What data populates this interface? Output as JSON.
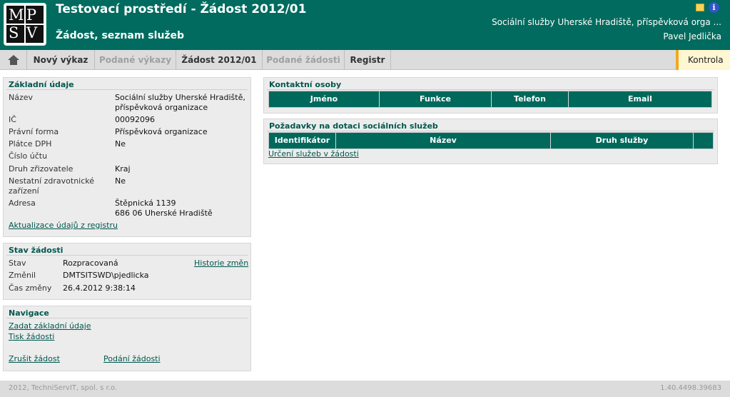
{
  "header": {
    "logo_letters": [
      "M",
      "P",
      "S",
      "V"
    ],
    "title": "Testovací prostředí - Žádost 2012/01",
    "subtitle": "Žádost, seznam služeb",
    "organization": "Sociální služby Uherské Hradiště, příspěvková orga ...",
    "user": "Pavel Jedlička",
    "icons": [
      "note-icon",
      "info-icon"
    ],
    "accent_color": "#006b5e"
  },
  "nav": {
    "items": [
      {
        "label": "Nový výkaz",
        "enabled": true
      },
      {
        "label": "Podané výkazy",
        "enabled": false
      },
      {
        "label": "Žádost 2012/01",
        "enabled": true
      },
      {
        "label": "Podané žádosti",
        "enabled": false
      },
      {
        "label": "Registr",
        "enabled": true
      }
    ],
    "kontrola": "Kontrola",
    "home_icon": "home-icon"
  },
  "zakladni": {
    "title": "Základní údaje",
    "rows": [
      {
        "label": "Název",
        "value": "Sociální služby Uherské Hradiště,",
        "value2": "příspěvková organizace"
      },
      {
        "label": "IČ",
        "value": "00092096"
      },
      {
        "label": "Právní forma",
        "value": "Příspěvková organizace"
      },
      {
        "label": "Plátce DPH",
        "value": "Ne"
      },
      {
        "label": "Číslo účtu",
        "value": ""
      },
      {
        "label": "Druh zřizovatele",
        "value": "Kraj"
      },
      {
        "label": "Nestatní zdravotnické",
        "label2": "zařízení",
        "value": "Ne"
      },
      {
        "label": "Adresa",
        "value": "Štěpnická 1139",
        "value2": "686 06 Uherské Hradiště"
      }
    ],
    "update_link": "Aktualizace údajů z registru"
  },
  "stav": {
    "title": "Stav žádosti",
    "rows": [
      {
        "label": "Stav",
        "value": "Rozpracovaná"
      },
      {
        "label": "Změnil",
        "value": "DMTSITSWD\\pjedlicka"
      },
      {
        "label": "Čas změny",
        "value": "26.4.2012 9:38:14"
      }
    ],
    "history_link": "Historie změn"
  },
  "navigace": {
    "title": "Navigace",
    "links": [
      "Zadat základní údaje",
      "Tisk žádosti",
      "Zrušit žádost",
      "Podání žádosti"
    ]
  },
  "kontakty": {
    "title": "Kontaktní osoby",
    "columns": [
      "Jméno",
      "Funkce",
      "Telefon",
      "Email"
    ]
  },
  "pozadavky": {
    "title": "Požadavky na dotaci sociálních služeb",
    "columns": [
      "Identifikátor",
      "Název",
      "Druh služby",
      ""
    ],
    "link": "Určení služeb v žádosti"
  },
  "footer": {
    "copyright": "2012, TechniServIT, spol. s r.o.",
    "version": "1.40.4498.39683"
  }
}
